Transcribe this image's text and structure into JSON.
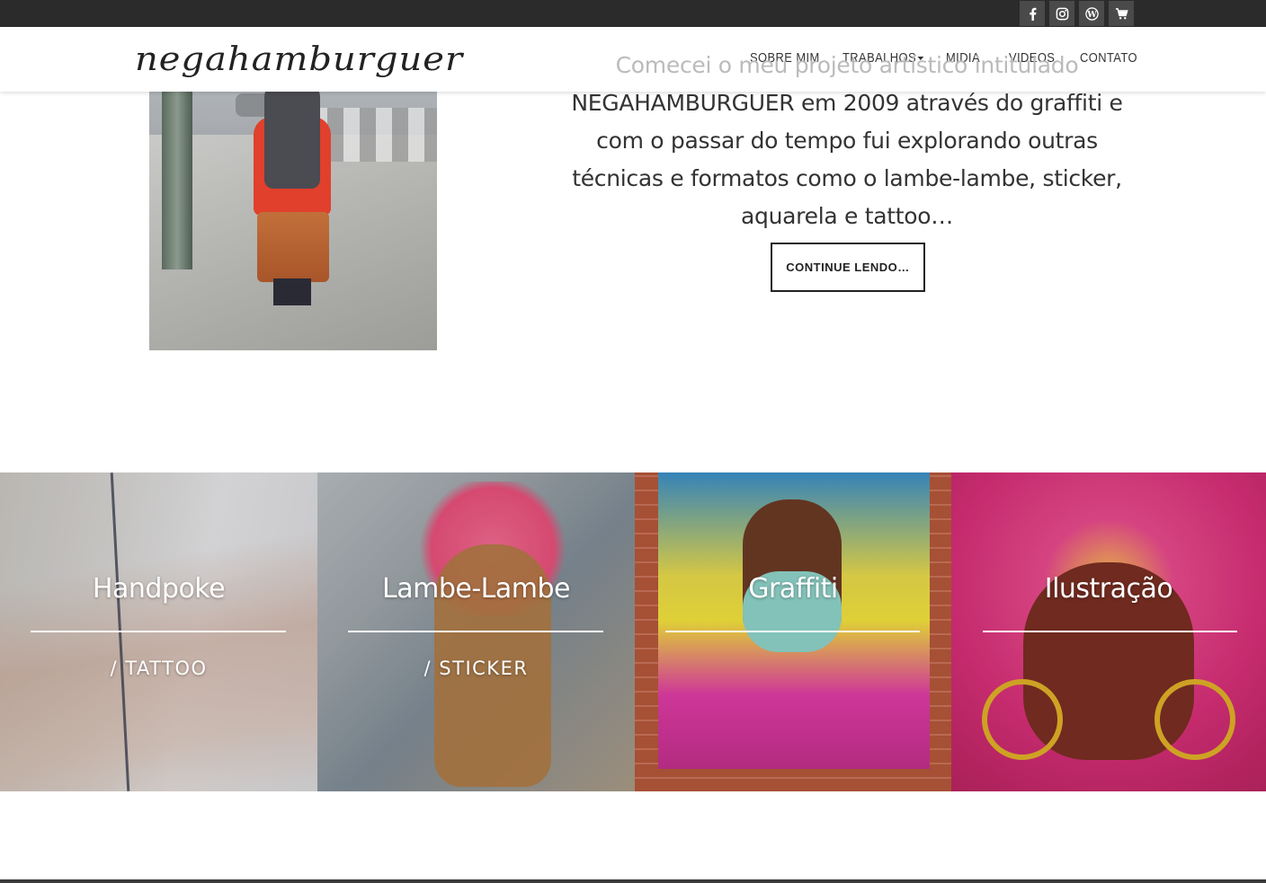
{
  "social": {
    "icons": [
      "facebook-icon",
      "instagram-icon",
      "wordpress-icon",
      "cart-icon"
    ],
    "button_color": "#4a4a4a",
    "bar_color": "#2b2b2b"
  },
  "brand": {
    "logo_text": "negahamburguer"
  },
  "nav": {
    "items": [
      {
        "label": "SOBRE MIM"
      },
      {
        "label": "TRABALHOS"
      },
      {
        "label": "MIDIA"
      },
      {
        "label": "VIDEOS"
      },
      {
        "label": "CONTATO"
      }
    ]
  },
  "intro": {
    "line1": "Comecei o meu projeto artístico intitulado",
    "rest": "NEGAHAMBURGUER em 2009 através do graffiti e com o passar do tempo fui explorando outras técnicas e formatos como o lambe-lambe, sticker, aquarela e tattoo…",
    "button_label": "CONTINUE LENDO…"
  },
  "tiles": [
    {
      "title": "Handpoke",
      "subtitle": "/ TATTOO"
    },
    {
      "title": "Lambe-Lambe",
      "subtitle": "/ STICKER"
    },
    {
      "title": "Graffiti",
      "subtitle": ""
    },
    {
      "title": "Ilustração",
      "subtitle": ""
    }
  ]
}
